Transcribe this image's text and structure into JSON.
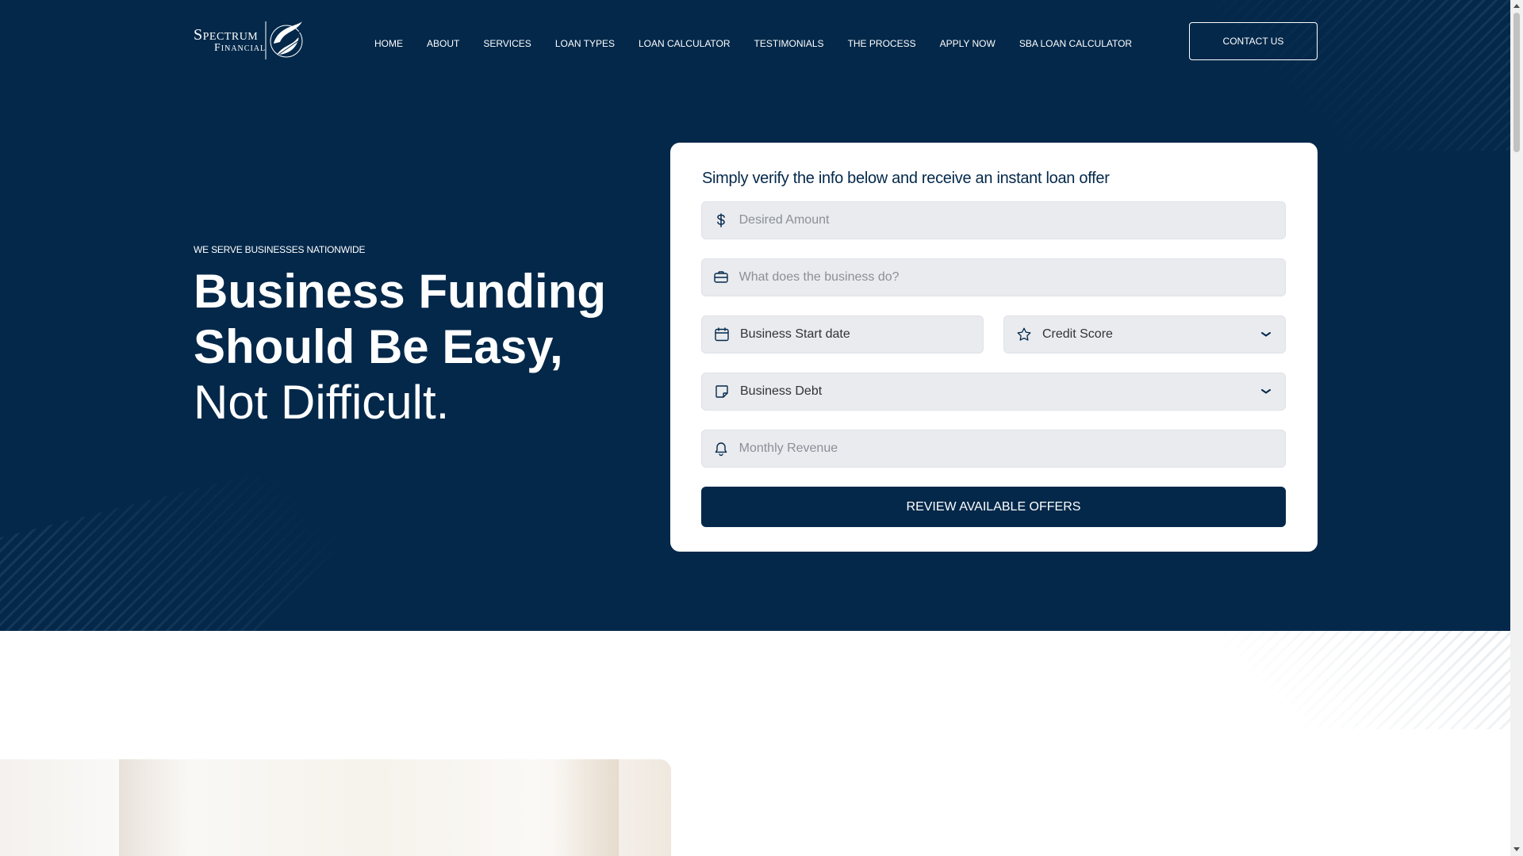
{
  "brand": {
    "line1": "Spectrum",
    "line2": "Financial"
  },
  "nav": {
    "items": [
      {
        "label": "HOME",
        "id": "home"
      },
      {
        "label": "ABOUT",
        "id": "about"
      },
      {
        "label": "SERVICES",
        "id": "services"
      },
      {
        "label": "LOAN TYPES",
        "id": "loan-types"
      },
      {
        "label": "LOAN CALCULATOR",
        "id": "loan-calculator"
      },
      {
        "label": "TESTIMONIALS",
        "id": "testimonials"
      },
      {
        "label": "THE PROCESS",
        "id": "the-process"
      },
      {
        "label": "APPLY NOW",
        "id": "apply-now"
      },
      {
        "label": "SBA LOAN CALCULATOR",
        "id": "sba-loan-calculator"
      }
    ],
    "contact_label": "CONTACT US"
  },
  "hero": {
    "tagline": "WE SERVE BUSINESSES NATIONWIDE",
    "headline_line1": "Business Funding",
    "headline_line2": "Should Be Easy,",
    "headline_line3": "Not Difficult."
  },
  "form": {
    "title": "Simply verify the info below and receive an instant loan offer",
    "desired_amount": {
      "placeholder": "Desired Amount",
      "value": "",
      "icon": "dollar-icon"
    },
    "business_description": {
      "placeholder": "What does the business do?",
      "value": "",
      "icon": "briefcase-icon"
    },
    "business_start_date": {
      "label": "Business Start date",
      "icon": "calendar-icon"
    },
    "credit_score": {
      "selected": "Credit Score",
      "icon": "star-icon"
    },
    "business_debt": {
      "selected": "Business Debt",
      "icon": "note-icon"
    },
    "monthly_revenue": {
      "placeholder": "Monthly Revenue",
      "value": "",
      "icon": "bell-icon"
    },
    "submit_label": "REVIEW AVAILABLE OFFERS"
  },
  "colors": {
    "navy": "#03284a",
    "field_bg": "#e9ebef",
    "white": "#ffffff"
  }
}
